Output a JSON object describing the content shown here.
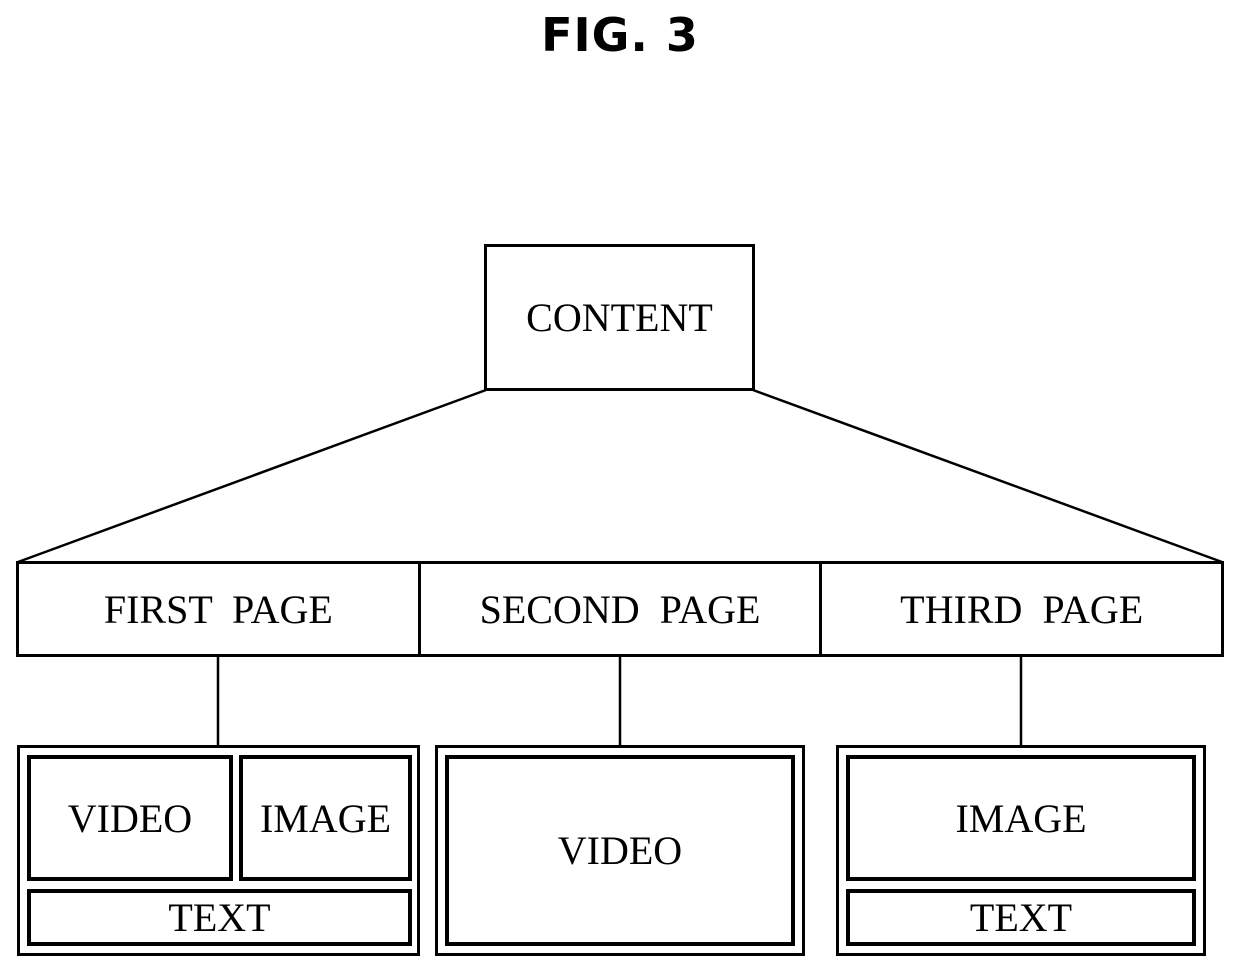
{
  "figure": {
    "title": "FIG. 3"
  },
  "root": {
    "label": "CONTENT"
  },
  "pages": [
    {
      "label": "FIRST  PAGE"
    },
    {
      "label": "SECOND  PAGE"
    },
    {
      "label": "THIRD  PAGE"
    }
  ],
  "layouts": {
    "first": {
      "video": "VIDEO",
      "image": "IMAGE",
      "text": "TEXT"
    },
    "second": {
      "video": "VIDEO"
    },
    "third": {
      "image": "IMAGE",
      "text": "TEXT"
    }
  }
}
